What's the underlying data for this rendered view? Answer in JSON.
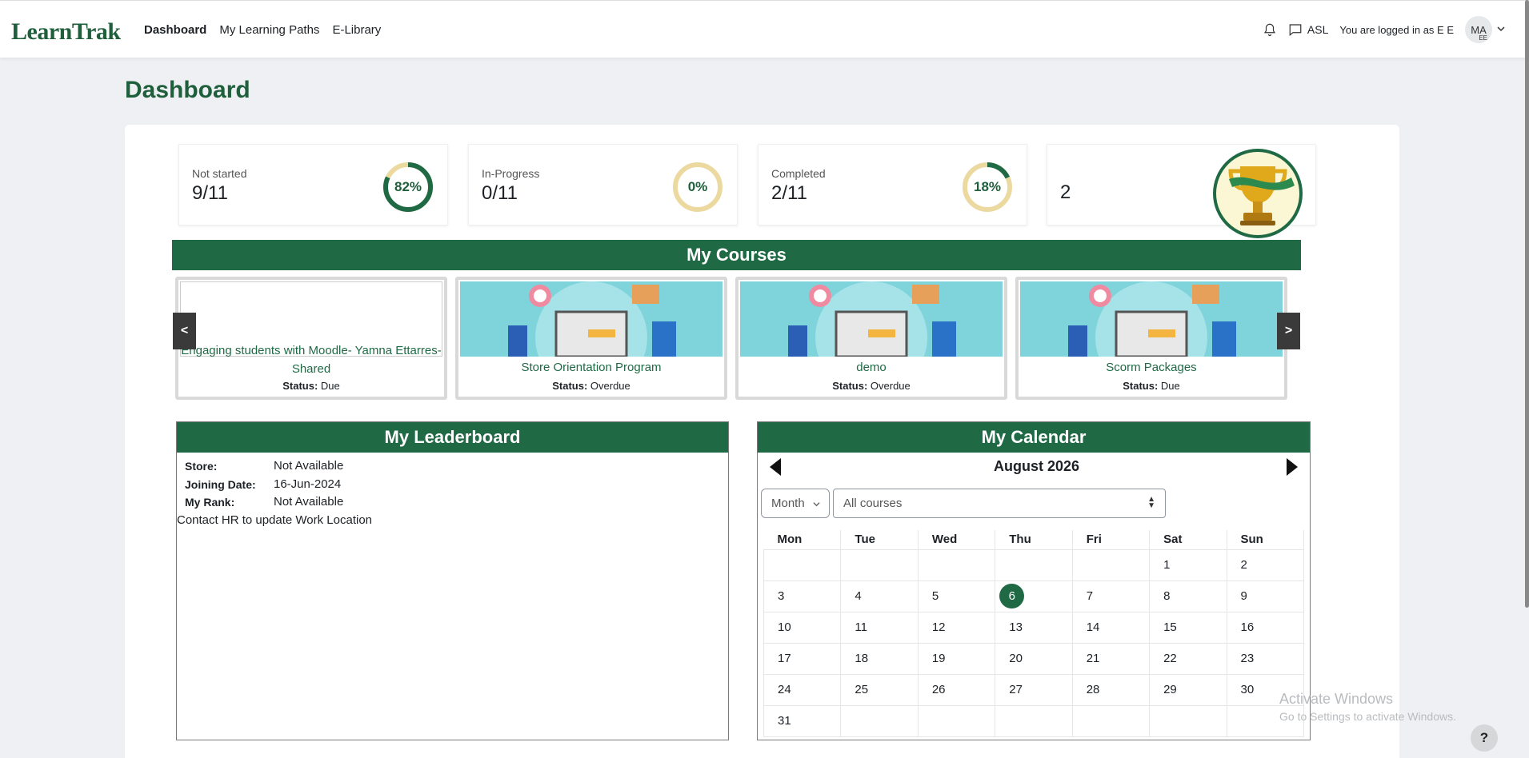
{
  "nav": {
    "logo_text": "LearnTrak",
    "links": [
      {
        "label": "Dashboard"
      },
      {
        "label": "My Learning Paths"
      },
      {
        "label": "E-Library"
      }
    ],
    "lang": "ASL",
    "login_text": "You are logged in as E E",
    "avatar_initials": "MA",
    "avatar_sub": "EE"
  },
  "page": {
    "title": "Dashboard"
  },
  "stats": [
    {
      "label": "Not started",
      "value": "9/11",
      "percent_text": "82%",
      "percent": 82
    },
    {
      "label": "In-Progress",
      "value": "0/11",
      "percent_text": "0%",
      "percent": 0
    },
    {
      "label": "Completed",
      "value": "2/11",
      "percent_text": "18%",
      "percent": 18
    },
    {
      "label": "",
      "value": "2"
    }
  ],
  "courses": {
    "title": "My Courses",
    "prev_label": "<",
    "next_label": ">",
    "status_label": "Status:",
    "items": [
      {
        "title": "Engaging students with Moodle- Yamna Ettarres- Shared",
        "status": "Due"
      },
      {
        "title": "Store Orientation Program",
        "status": "Overdue"
      },
      {
        "title": "demo",
        "status": "Overdue"
      },
      {
        "title": "Scorm Packages",
        "status": "Due"
      }
    ]
  },
  "leaderboard": {
    "title": "My Leaderboard",
    "rows": [
      {
        "key": "Store:",
        "value": "Not Available"
      },
      {
        "key": "Joining Date:",
        "value": "16-Jun-2024"
      },
      {
        "key": "My Rank:",
        "value": "Not Available"
      }
    ],
    "note": "Contact HR to update Work Location"
  },
  "calendar": {
    "title": "My Calendar",
    "month_label": "August 2026",
    "view_select": "Month",
    "course_select": "All courses",
    "weekdays": [
      "Mon",
      "Tue",
      "Wed",
      "Thu",
      "Fri",
      "Sat",
      "Sun"
    ],
    "weeks": [
      [
        "",
        "",
        "",
        "",
        "",
        "1",
        "2"
      ],
      [
        "3",
        "4",
        "5",
        "6",
        "7",
        "8",
        "9"
      ],
      [
        "10",
        "11",
        "12",
        "13",
        "14",
        "15",
        "16"
      ],
      [
        "17",
        "18",
        "19",
        "20",
        "21",
        "22",
        "23"
      ],
      [
        "24",
        "25",
        "26",
        "27",
        "28",
        "29",
        "30"
      ],
      [
        "31",
        "",
        "",
        "",
        "",
        "",
        ""
      ]
    ],
    "today": "6"
  },
  "watermark": {
    "line1": "Activate Windows",
    "line2": "Go to Settings to activate Windows."
  },
  "help_label": "?",
  "colors": {
    "brand_green": "#1f6a45",
    "ring_track": "#ecd9a0"
  }
}
